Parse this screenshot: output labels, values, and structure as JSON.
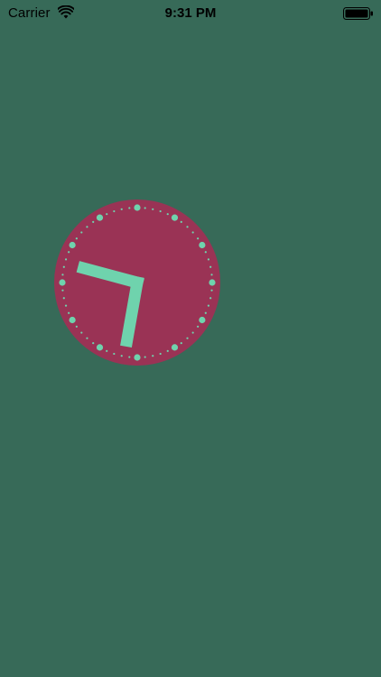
{
  "status_bar": {
    "carrier": "Carrier",
    "time": "9:31 PM",
    "wifi_icon": "wifi-icon",
    "battery_icon": "battery-full-icon"
  },
  "clock": {
    "hour": 9,
    "minute": 31,
    "face_color": "#9a3355",
    "hand_color": "#6fd3ad",
    "background_color": "#376a58"
  }
}
